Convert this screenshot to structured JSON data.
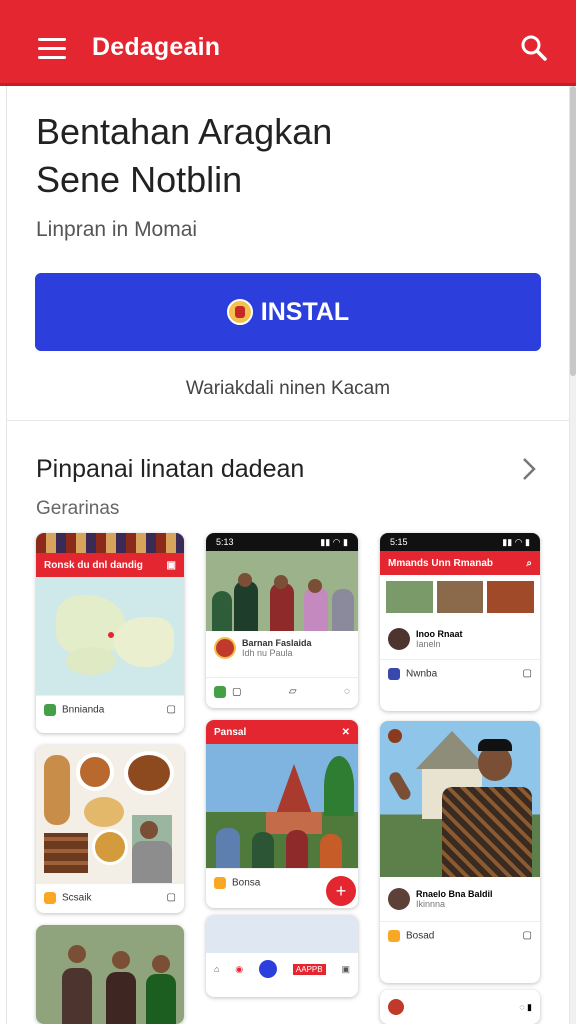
{
  "appbar": {
    "title": "Dedageain",
    "menu_icon": "menu-icon",
    "search_icon": "search-icon",
    "color": "#e3262f"
  },
  "hero": {
    "headline_line1": "Bentahan Aragkan",
    "headline_line2": "Sene Notblin",
    "subtitle": "Linpran in Momai",
    "install_label": "INSTAL",
    "install_color": "#2c3fdc",
    "install_note": "Wariakdali ninen Kacam"
  },
  "section": {
    "title": "Pinpanai linatan dadean",
    "subtitle": "Gerarinas",
    "chevron_icon": "chevron-right-icon"
  },
  "screenshots": {
    "s1": {
      "bar": "Ronsk du dnl dandig",
      "footer": "Bnnianda"
    },
    "s2": {
      "time": "5:13",
      "card_title": "Barnan Faslaida",
      "card_sub": "Idh nu Paula"
    },
    "s3": {
      "time": "5:15",
      "bar": "Mmands Unn Rmanab",
      "card_title": "Inoo Rnaat",
      "card_sub": "Ianeln",
      "footer": "Nwnba"
    },
    "s4": {
      "footer": "Scsaik"
    },
    "s5": {
      "bar": "Pansal",
      "footer": "Bonsa"
    },
    "s6": {
      "card_title": "Rnaelo Bna Baldil",
      "card_sub": "Ikinnna",
      "footer": "Bosad"
    },
    "s7": {
      "nav_label": "AAPPB"
    }
  }
}
